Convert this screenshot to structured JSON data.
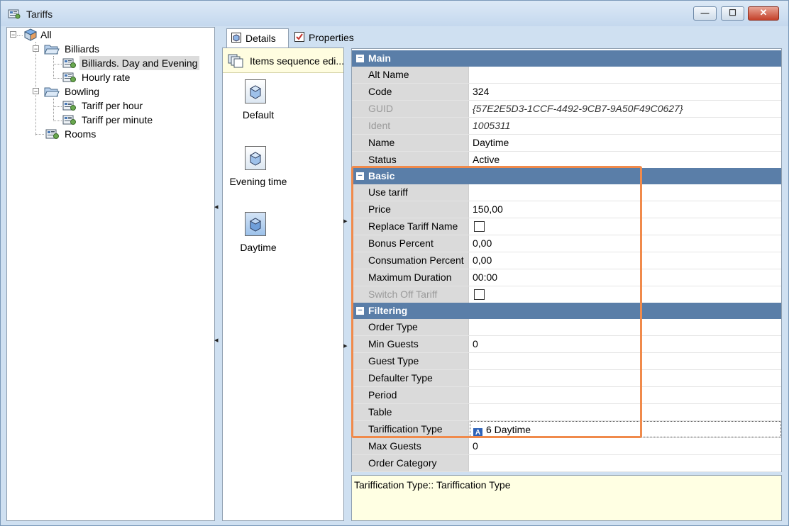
{
  "window": {
    "title": "Tariffs",
    "minimize_glyph": "—",
    "maximize_glyph": "☐",
    "close_glyph": "✕"
  },
  "tree": {
    "root": "All",
    "billiards": "Billiards",
    "billiards_day_evening": "Billiards. Day and Evening",
    "hourly_rate": "Hourly rate",
    "bowling": "Bowling",
    "tariff_per_hour": "Tariff per hour",
    "tariff_per_minute": "Tariff per minute",
    "rooms": "Rooms"
  },
  "tabs": {
    "details": "Details",
    "properties": "Properties"
  },
  "items_panel": {
    "header": "Items sequence edi...",
    "items": [
      "Default",
      "Evening time",
      "Daytime"
    ]
  },
  "grid": {
    "main": {
      "title": "Main",
      "alt_name_label": "Alt Name",
      "alt_name_value": "",
      "code_label": "Code",
      "code_value": "324",
      "guid_label": "GUID",
      "guid_value": "{57E2E5D3-1CCF-4492-9CB7-9A50F49C0627}",
      "ident_label": "Ident",
      "ident_value": "1005311",
      "name_label": "Name",
      "name_value": "Daytime",
      "status_label": "Status",
      "status_value": "Active"
    },
    "basic": {
      "title": "Basic",
      "use_tariff_label": "Use tariff",
      "use_tariff_value": "",
      "price_label": "Price",
      "price_value": "150,00",
      "replace_tariff_name_label": "Replace Tariff Name",
      "bonus_percent_label": "Bonus Percent",
      "bonus_percent_value": "0,00",
      "consumation_percent_label": "Consumation Percent",
      "consumation_percent_value": "0,00",
      "maximum_duration_label": "Maximum Duration",
      "maximum_duration_value": "00:00",
      "switch_off_tariff_label": "Switch Off Tariff"
    },
    "filtering": {
      "title": "Filtering",
      "order_type_label": "Order Type",
      "order_type_value": "",
      "min_guests_label": "Min Guests",
      "min_guests_value": "0",
      "guest_type_label": "Guest Type",
      "guest_type_value": "",
      "defaulter_type_label": "Defaulter Type",
      "defaulter_type_value": "",
      "period_label": "Period",
      "period_value": "",
      "table_label": "Table",
      "table_value": "",
      "tariffication_type_label": "Tariffication Type",
      "tariffication_type_badge": "A",
      "tariffication_type_value": "6 Daytime",
      "max_guests_label": "Max Guests",
      "max_guests_value": "0",
      "order_category_label": "Order Category",
      "order_category_value": ""
    }
  },
  "description": "Tariffication Type:: Tariffication Type",
  "colors": {
    "category_header": "#5a7ea8",
    "highlight": "#f08a4b",
    "description_bg": "#ffffe3"
  }
}
